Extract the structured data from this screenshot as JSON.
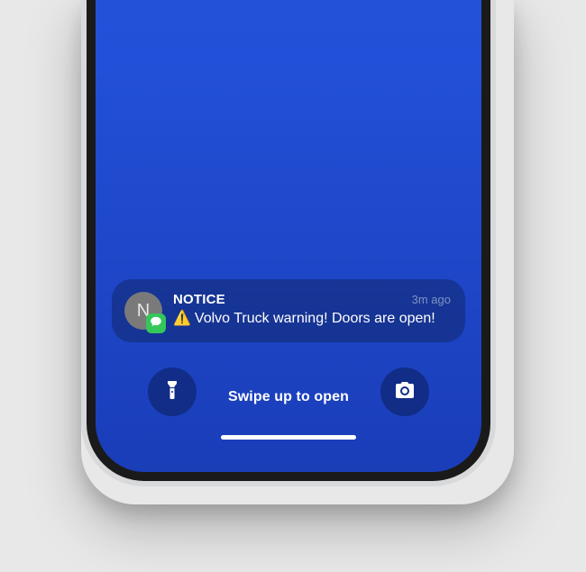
{
  "notification": {
    "avatar_initial": "N",
    "title": "NOTICE",
    "time": "3m ago",
    "message_prefix_emoji": "⚠️",
    "message": "Volvo Truck warning! Doors are open!"
  },
  "lockscreen": {
    "swipe_hint": "Swipe up to open"
  },
  "icons": {
    "messages": "messages-icon",
    "flashlight": "flashlight-icon",
    "camera": "camera-icon"
  },
  "colors": {
    "wallpaper_top": "#2a5de0",
    "wallpaper_bottom": "#1a3db8",
    "notification_bg": "rgba(17,40,110,0.55)",
    "badge_green": "#34c759"
  }
}
